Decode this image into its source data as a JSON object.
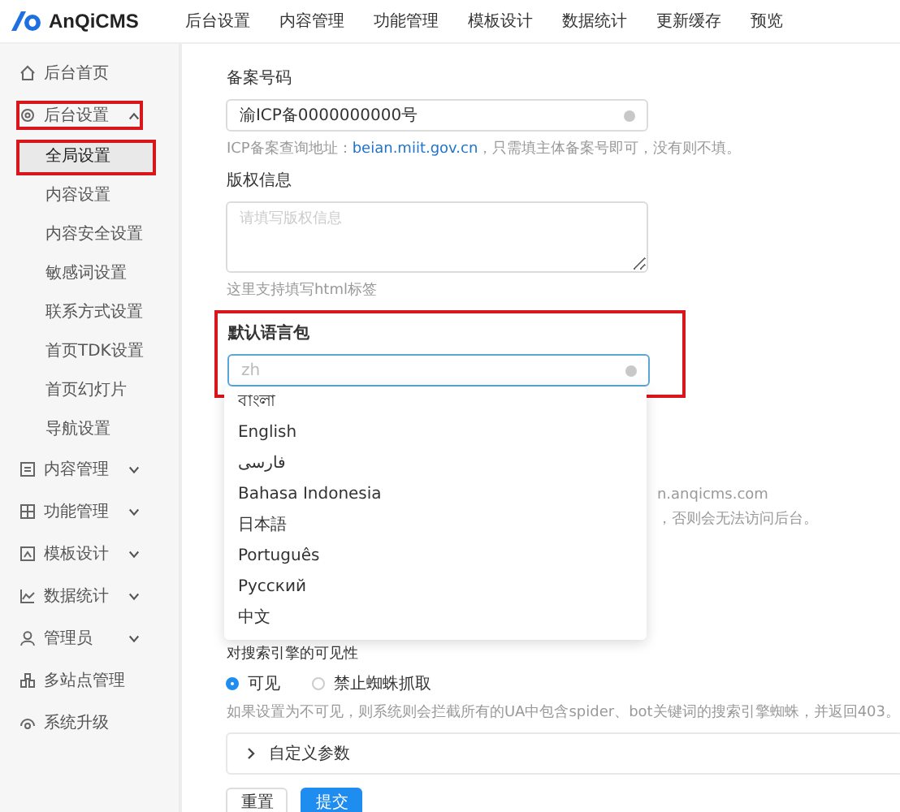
{
  "header": {
    "logo": "AnQiCMS",
    "nav": [
      "后台设置",
      "内容管理",
      "功能管理",
      "模板设计",
      "数据统计",
      "更新缓存",
      "预览"
    ]
  },
  "sidebar": {
    "items": [
      {
        "label": "后台首页",
        "selected": false,
        "highlighted": false
      },
      {
        "label": "后台设置",
        "selected": false,
        "highlighted": true,
        "expanded": true,
        "children": [
          {
            "label": "全局设置",
            "selected": true,
            "highlighted": true
          },
          {
            "label": "内容设置",
            "selected": false,
            "highlighted": false
          },
          {
            "label": "内容安全设置",
            "selected": false,
            "highlighted": false
          },
          {
            "label": "敏感词设置",
            "selected": false,
            "highlighted": false
          },
          {
            "label": "联系方式设置",
            "selected": false,
            "highlighted": false
          },
          {
            "label": "首页TDK设置",
            "selected": false,
            "highlighted": false
          },
          {
            "label": "首页幻灯片",
            "selected": false,
            "highlighted": false
          },
          {
            "label": "导航设置",
            "selected": false,
            "highlighted": false
          }
        ]
      },
      {
        "label": "内容管理",
        "selected": false,
        "highlighted": false,
        "expanded": false
      },
      {
        "label": "功能管理",
        "selected": false,
        "highlighted": false,
        "expanded": false
      },
      {
        "label": "模板设计",
        "selected": false,
        "highlighted": false,
        "expanded": false
      },
      {
        "label": "数据统计",
        "selected": false,
        "highlighted": false,
        "expanded": false
      },
      {
        "label": "管理员",
        "selected": false,
        "highlighted": false,
        "expanded": false
      },
      {
        "label": "多站点管理",
        "selected": false,
        "highlighted": false
      },
      {
        "label": "系统升级",
        "selected": false,
        "highlighted": false
      }
    ]
  },
  "form": {
    "icp": {
      "label": "备案号码",
      "value": "渝ICP备0000000000号",
      "hint_before": "ICP备案查询地址：",
      "hint_link": "beian.miit.gov.cn",
      "hint_after": "，只需填主体备案号即可，没有则不填。"
    },
    "copyright": {
      "label": "版权信息",
      "placeholder": "请填写版权信息",
      "hint": "这里支持填写html标签"
    },
    "language": {
      "label": "默认语言包",
      "placeholder": "zh",
      "highlighted": true,
      "options": [
        {
          "label": "বাংলা",
          "selected": false
        },
        {
          "label": "English",
          "selected": false
        },
        {
          "label": "فارسی",
          "selected": false
        },
        {
          "label": "Bahasa Indonesia",
          "selected": false
        },
        {
          "label": "日本語",
          "selected": false
        },
        {
          "label": "Português",
          "selected": false
        },
        {
          "label": "Русский",
          "selected": false
        },
        {
          "label": "中文",
          "selected": false
        }
      ]
    },
    "hidden_hints": [
      "n.anqicms.com",
      "，否则会无法访问后台。"
    ],
    "visibility": {
      "label": "对搜索引擎的可见性",
      "options": [
        {
          "label": "可见",
          "selected": true
        },
        {
          "label": "禁止蜘蛛抓取",
          "selected": false
        }
      ],
      "hint": "如果设置为不可见，则系统则会拦截所有的UA中包含spider、bot关键词的搜索引擎蜘蛛，并返回403。"
    },
    "custom": {
      "label": "自定义参数",
      "expanded": false
    },
    "buttons": [
      {
        "label": "重置",
        "kind": "default"
      },
      {
        "label": "提交",
        "kind": "primary"
      }
    ]
  }
}
